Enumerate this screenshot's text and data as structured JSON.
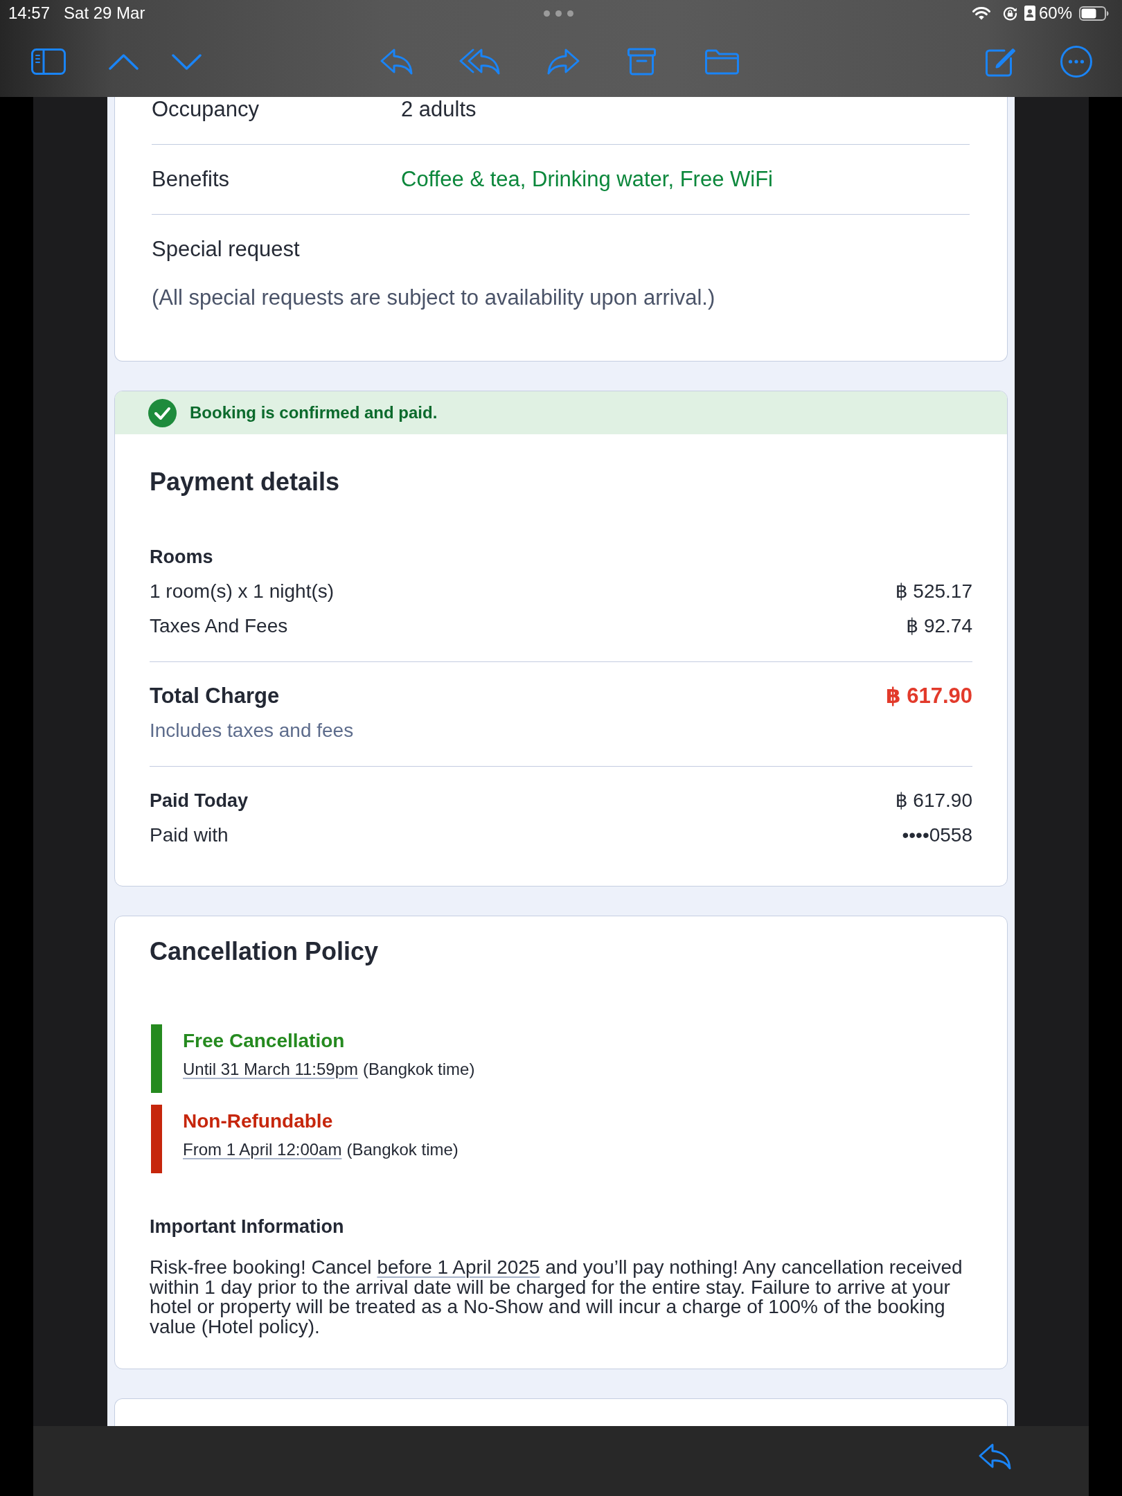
{
  "status_bar": {
    "time": "14:57",
    "date": "Sat 29 Mar",
    "battery": "60%"
  },
  "booking_details": {
    "rows": [
      {
        "kind": "plain",
        "label": "Occupancy",
        "value": "2 adults"
      },
      {
        "kind": "highlight",
        "label": "Benefits",
        "value": "Coffee & tea, Drinking water, Free WiFi"
      }
    ],
    "special_request": {
      "label": "Special request",
      "note": "(All special requests are subject to availability upon arrival.)"
    }
  },
  "payment": {
    "status": "Booking is confirmed and paid.",
    "title": "Payment details",
    "sections": [
      {
        "lines": [
          {
            "kind": "heading",
            "label": "Rooms"
          },
          {
            "kind": "item",
            "label": "1 room(s) x 1 night(s)",
            "amount": "฿ 525.17"
          },
          {
            "kind": "item",
            "label": "Taxes And Fees",
            "amount": "฿ 92.74"
          }
        ]
      },
      {
        "lines": [
          {
            "kind": "total",
            "label": "Total Charge",
            "amount": "฿ 617.90"
          },
          {
            "kind": "note",
            "label": "Includes taxes and fees"
          }
        ]
      },
      {
        "lines": [
          {
            "kind": "heading",
            "label": "Paid Today",
            "amount": "฿ 617.90"
          },
          {
            "kind": "item",
            "label": "Paid with",
            "amount": "••••0558"
          }
        ]
      }
    ]
  },
  "cancellation": {
    "title": "Cancellation Policy",
    "tiers": [
      {
        "title": "Free Cancellation",
        "period": "Until 31 March 11:59pm",
        "zone": "(Bangkok time)",
        "color": "#258a1f"
      },
      {
        "title": "Non-Refundable",
        "period": "From 1 April 12:00am",
        "zone": "(Bangkok time)",
        "color": "#c6260c"
      }
    ],
    "info": {
      "title": "Important Information",
      "text_before": "Risk-free booking! Cancel",
      "link": "before 1 April 2025",
      "text_after": "and you’ll pay nothing! Any cancellation received within 1 day prior to the arrival date will be charged for the entire stay. Failure to arrive at your hotel or property will be treated as a No-Show and will incur a charge of 100% of the booking value (Hotel policy)."
    }
  }
}
